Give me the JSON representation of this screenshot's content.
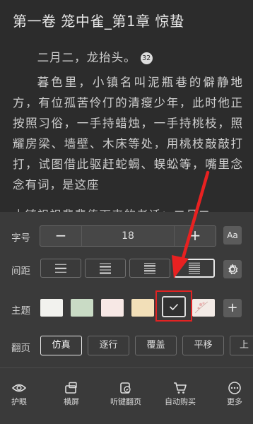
{
  "reader": {
    "chapter_title": "第一卷 笼中雀_第1章 惊蛰",
    "para1": "二月二，龙抬头。",
    "note_badge": "32",
    "para2": "暮色里，小镇名叫泥瓶巷的僻静地方，有位孤苦伶仃的清瘦少年，此时他正按照习俗，一手持蜡烛，一手持桃枝，照耀房梁、墙壁、木床等处，用桃枝敲敲打打，试图借此驱赶蛇蝎、蜈蚣等，嘴里念念有词，是这座",
    "para3": "小镇祖祖辈辈传下来的老话：二月二，"
  },
  "settings": {
    "font_size_label": "字号",
    "font_minus": "−",
    "font_value": "18",
    "font_plus": "+",
    "font_type_btn": "Aa",
    "spacing_label": "间距",
    "theme_label": "主题",
    "theme_add": "+",
    "page_turn_label": "翻页",
    "page_turn_options": [
      "仿真",
      "逐行",
      "覆盖",
      "平移",
      "上下"
    ]
  },
  "theme_colors": [
    "#f2f2ee",
    "#c9dbc5",
    "#f7e8e5",
    "#f2dfb8",
    "#303030",
    "#f3ebe6"
  ],
  "accent_colors": {
    "annotation_red": "#e12323",
    "background": "#3a3a3a"
  },
  "bottom_bar": {
    "items": [
      {
        "label": "护眼",
        "icon": "eye-icon"
      },
      {
        "label": "横屏",
        "icon": "rotate-screen-icon"
      },
      {
        "label": "听键翻页",
        "icon": "volume-page-icon"
      },
      {
        "label": "自动购买",
        "icon": "cart-icon"
      },
      {
        "label": "更多",
        "icon": "more-icon"
      }
    ]
  }
}
